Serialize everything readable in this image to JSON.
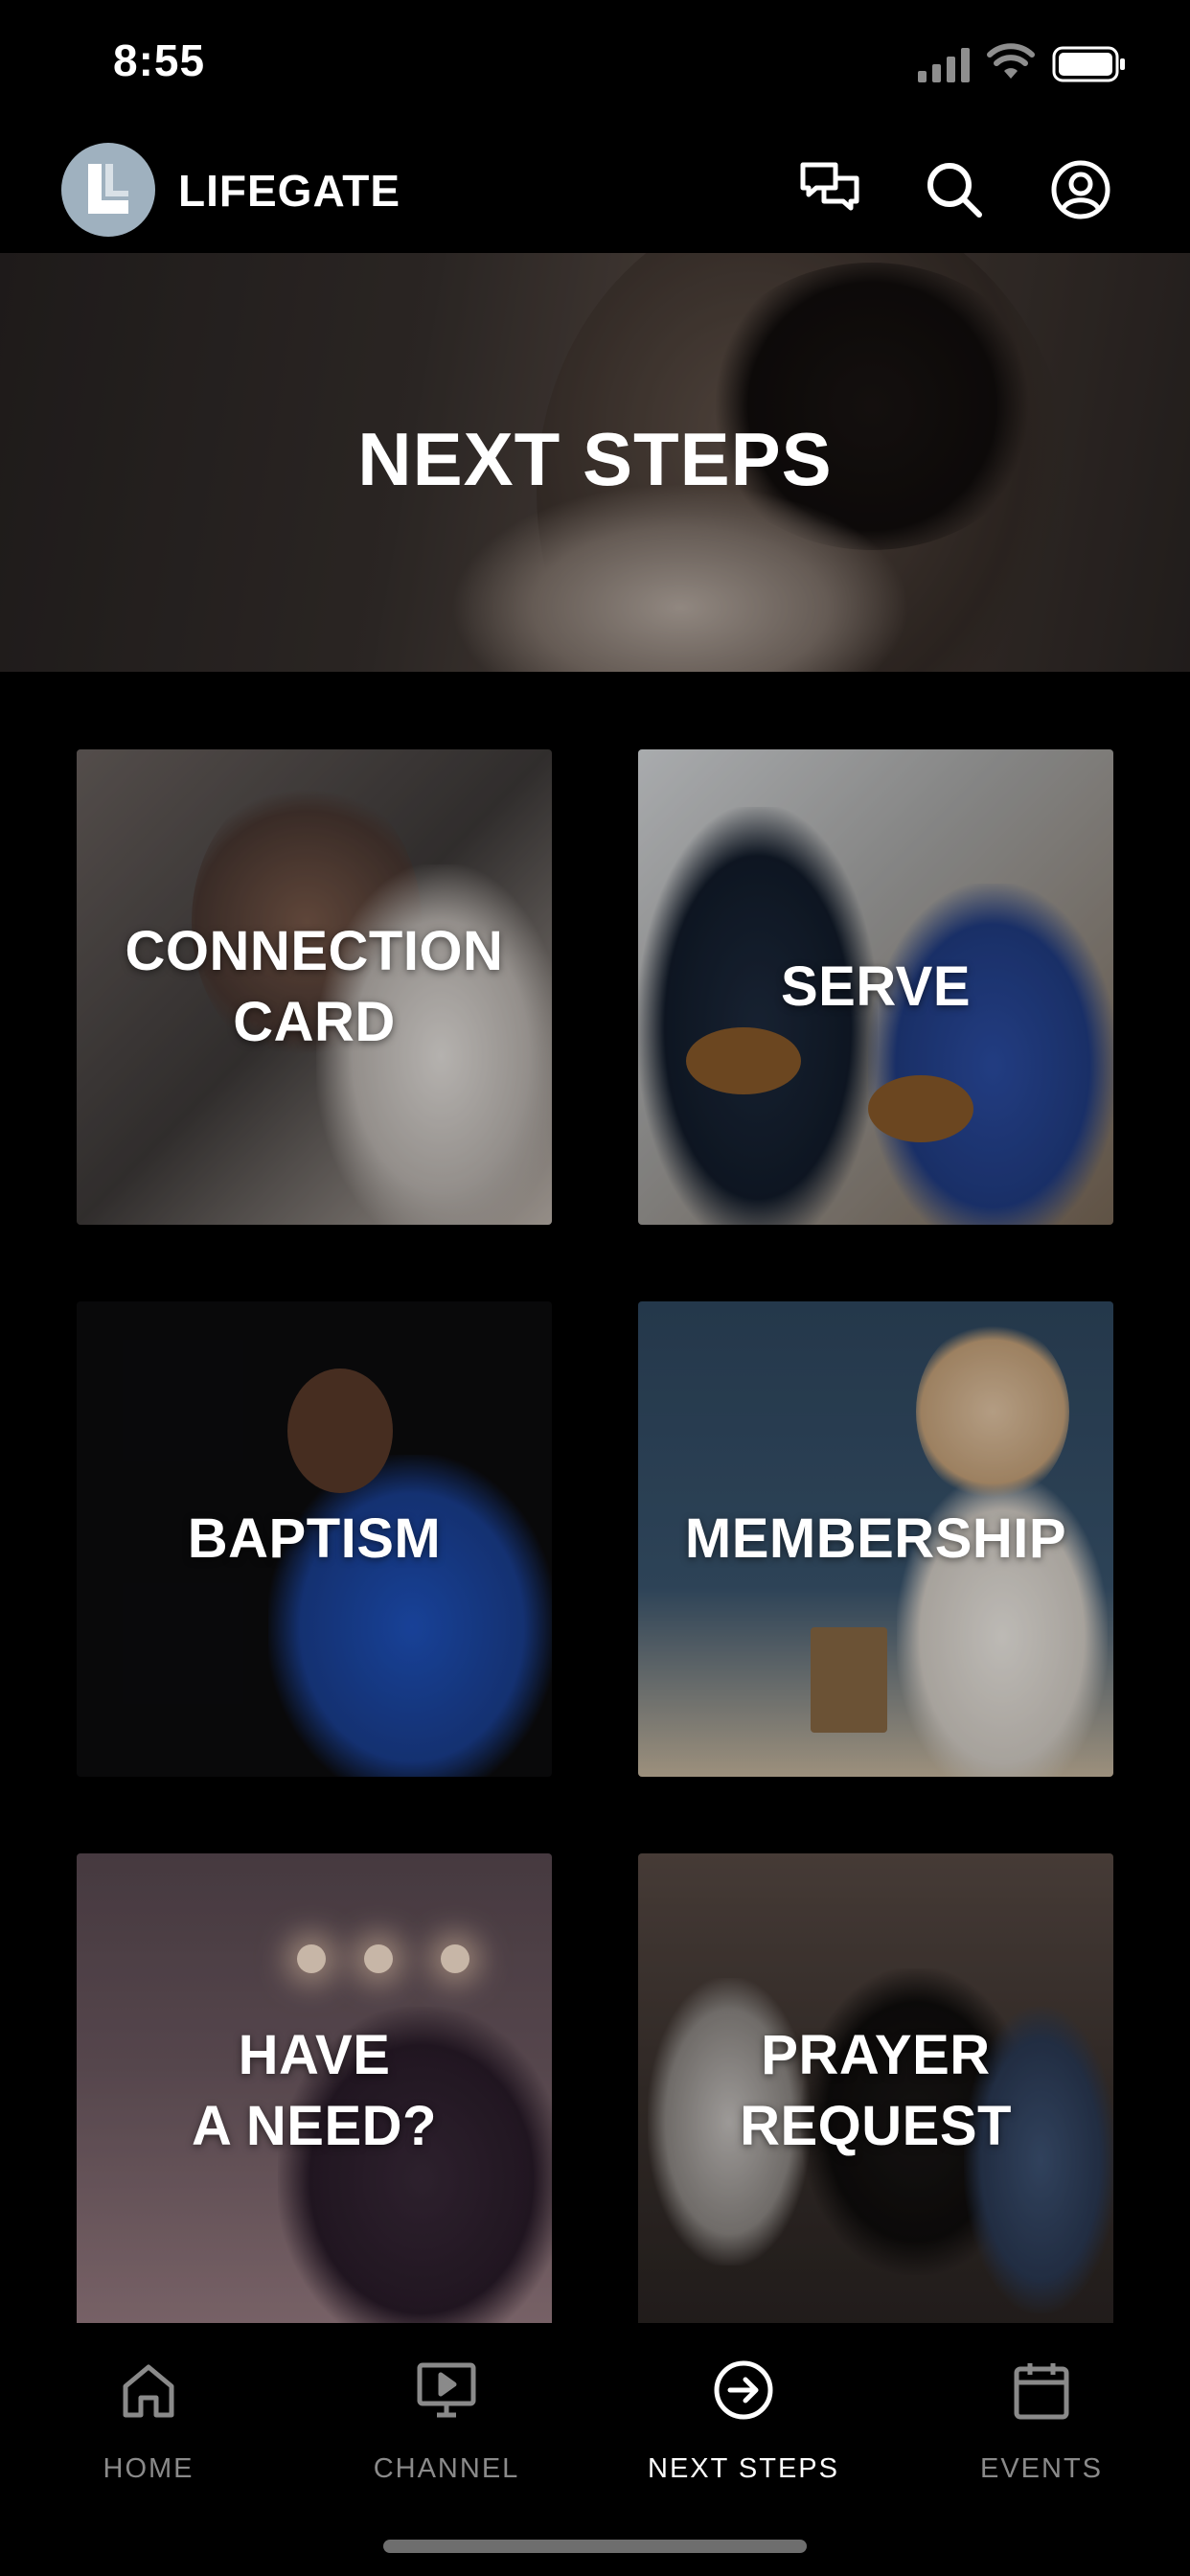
{
  "status_bar": {
    "time": "8:55"
  },
  "header": {
    "app_name": "LIFEGATE",
    "logo_icon": "lifegate-logo-icon",
    "icons": [
      "chat-icon",
      "search-icon",
      "account-icon"
    ]
  },
  "hero": {
    "title": "NEXT STEPS"
  },
  "tiles": [
    {
      "label": "CONNECTION\nCARD"
    },
    {
      "label": "SERVE"
    },
    {
      "label": "BAPTISM"
    },
    {
      "label": "MEMBERSHIP"
    },
    {
      "label": "HAVE\nA NEED?"
    },
    {
      "label": "PRAYER\nREQUEST"
    }
  ],
  "nav": {
    "items": [
      {
        "label": "HOME",
        "icon": "home-icon",
        "active": false
      },
      {
        "label": "CHANNEL",
        "icon": "tv-icon",
        "active": false
      },
      {
        "label": "NEXT STEPS",
        "icon": "arrow-circle-right-icon",
        "active": true
      },
      {
        "label": "EVENTS",
        "icon": "calendar-icon",
        "active": false
      }
    ]
  },
  "colors": {
    "background": "#000000",
    "active_nav": "#ffffff",
    "inactive_nav": "#8a8a8a"
  }
}
